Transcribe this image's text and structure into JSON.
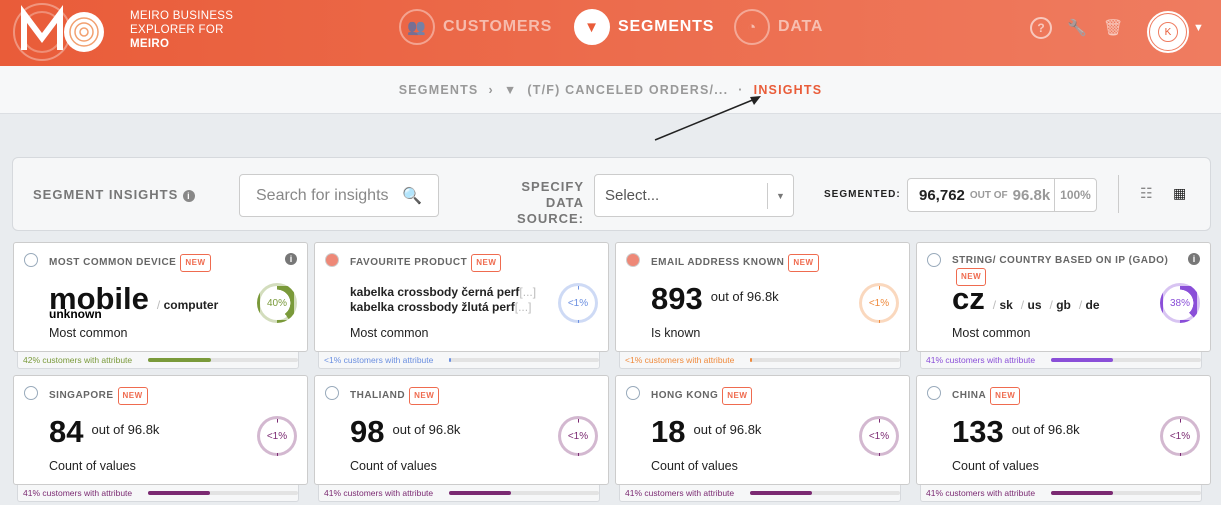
{
  "header": {
    "brand_line1": "MEIRO BUSINESS",
    "brand_line2": "EXPLORER FOR",
    "brand_line3": "MEIRO",
    "nav": [
      {
        "label": "CUSTOMERS",
        "icon": "users-icon"
      },
      {
        "label": "SEGMENTS",
        "icon": "funnel-icon",
        "active": true
      },
      {
        "label": "DATA",
        "icon": "gauge-icon"
      }
    ],
    "avatar_initial": "K"
  },
  "breadcrumb": {
    "root": "SEGMENTS",
    "segment": "(T/F) CANCELED ORDERS/...",
    "current": "INSIGHTS"
  },
  "toolbar": {
    "title": "SEGMENT INSIGHTS",
    "search_placeholder": "Search for insights",
    "source_label": "SPECIFY DATA SOURCE:",
    "source_value": "Select...",
    "segmented_label": "SEGMENTED:",
    "segmented_count": "96,762",
    "out_of": "OUT OF",
    "total": "96.8k",
    "percent": "100%"
  },
  "cards": [
    {
      "title": "MOST COMMON DEVICE",
      "badge": "NEW",
      "info": true,
      "type": "common",
      "value": "mobile",
      "others": [
        "computer"
      ],
      "extra": "unknown",
      "label": "Most common",
      "ring": "40%",
      "ring_value": 40,
      "color": "#7a9a3a",
      "footer": "42% customers with attribute",
      "attr_pct": 42
    },
    {
      "title": "FAVOURITE PRODUCT",
      "badge": "NEW",
      "type": "products",
      "products": [
        "kabelka crossbody černá perf",
        "kabelka crossbody žlutá perf"
      ],
      "ellipsis": "[...]",
      "label": "Most common",
      "ring": "<1%",
      "ring_value": 0.5,
      "color": "#6b8fe0",
      "footer": "<1% customers with attribute",
      "attr_pct": 0.5
    },
    {
      "title": "EMAIL ADDRESS KNOWN",
      "badge": "NEW",
      "type": "count",
      "value": "893",
      "out_of": "out of 96.8k",
      "label": "Is known",
      "ring": "<1%",
      "ring_value": 0.9,
      "color": "#ef8a3c",
      "footer": "<1% customers with attribute",
      "attr_pct": 0.9
    },
    {
      "title": "STRING/ COUNTRY BASED ON IP (GADO)",
      "badge": "NEW",
      "info": true,
      "type": "common",
      "value": "cz",
      "others": [
        "sk",
        "us",
        "gb",
        "de"
      ],
      "label": "Most common",
      "ring": "38%",
      "ring_value": 38,
      "color": "#8a4fd8",
      "footer": "41% customers with attribute",
      "attr_pct": 41
    },
    {
      "title": "SINGAPORE",
      "badge": "NEW",
      "type": "count",
      "value": "84",
      "out_of": "out of 96.8k",
      "label": "Count of values",
      "ring": "<1%",
      "ring_value": 0.1,
      "color": "#7b2a72",
      "footer": "41% customers with attribute",
      "attr_pct": 41
    },
    {
      "title": "THALIAND",
      "badge": "NEW",
      "type": "count",
      "value": "98",
      "out_of": "out of 96.8k",
      "label": "Count of values",
      "ring": "<1%",
      "ring_value": 0.1,
      "color": "#7b2a72",
      "footer": "41% customers with attribute",
      "attr_pct": 41
    },
    {
      "title": "HONG KONG",
      "badge": "NEW",
      "type": "count",
      "value": "18",
      "out_of": "out of 96.8k",
      "label": "Count of values",
      "ring": "<1%",
      "ring_value": 0.1,
      "color": "#7b2a72",
      "footer": "41% customers with attribute",
      "attr_pct": 41
    },
    {
      "title": "CHINA",
      "badge": "NEW",
      "type": "count",
      "value": "133",
      "out_of": "out of 96.8k",
      "label": "Count of values",
      "ring": "<1%",
      "ring_value": 0.1,
      "color": "#7b2a72",
      "footer": "41% customers with attribute",
      "attr_pct": 41
    }
  ]
}
